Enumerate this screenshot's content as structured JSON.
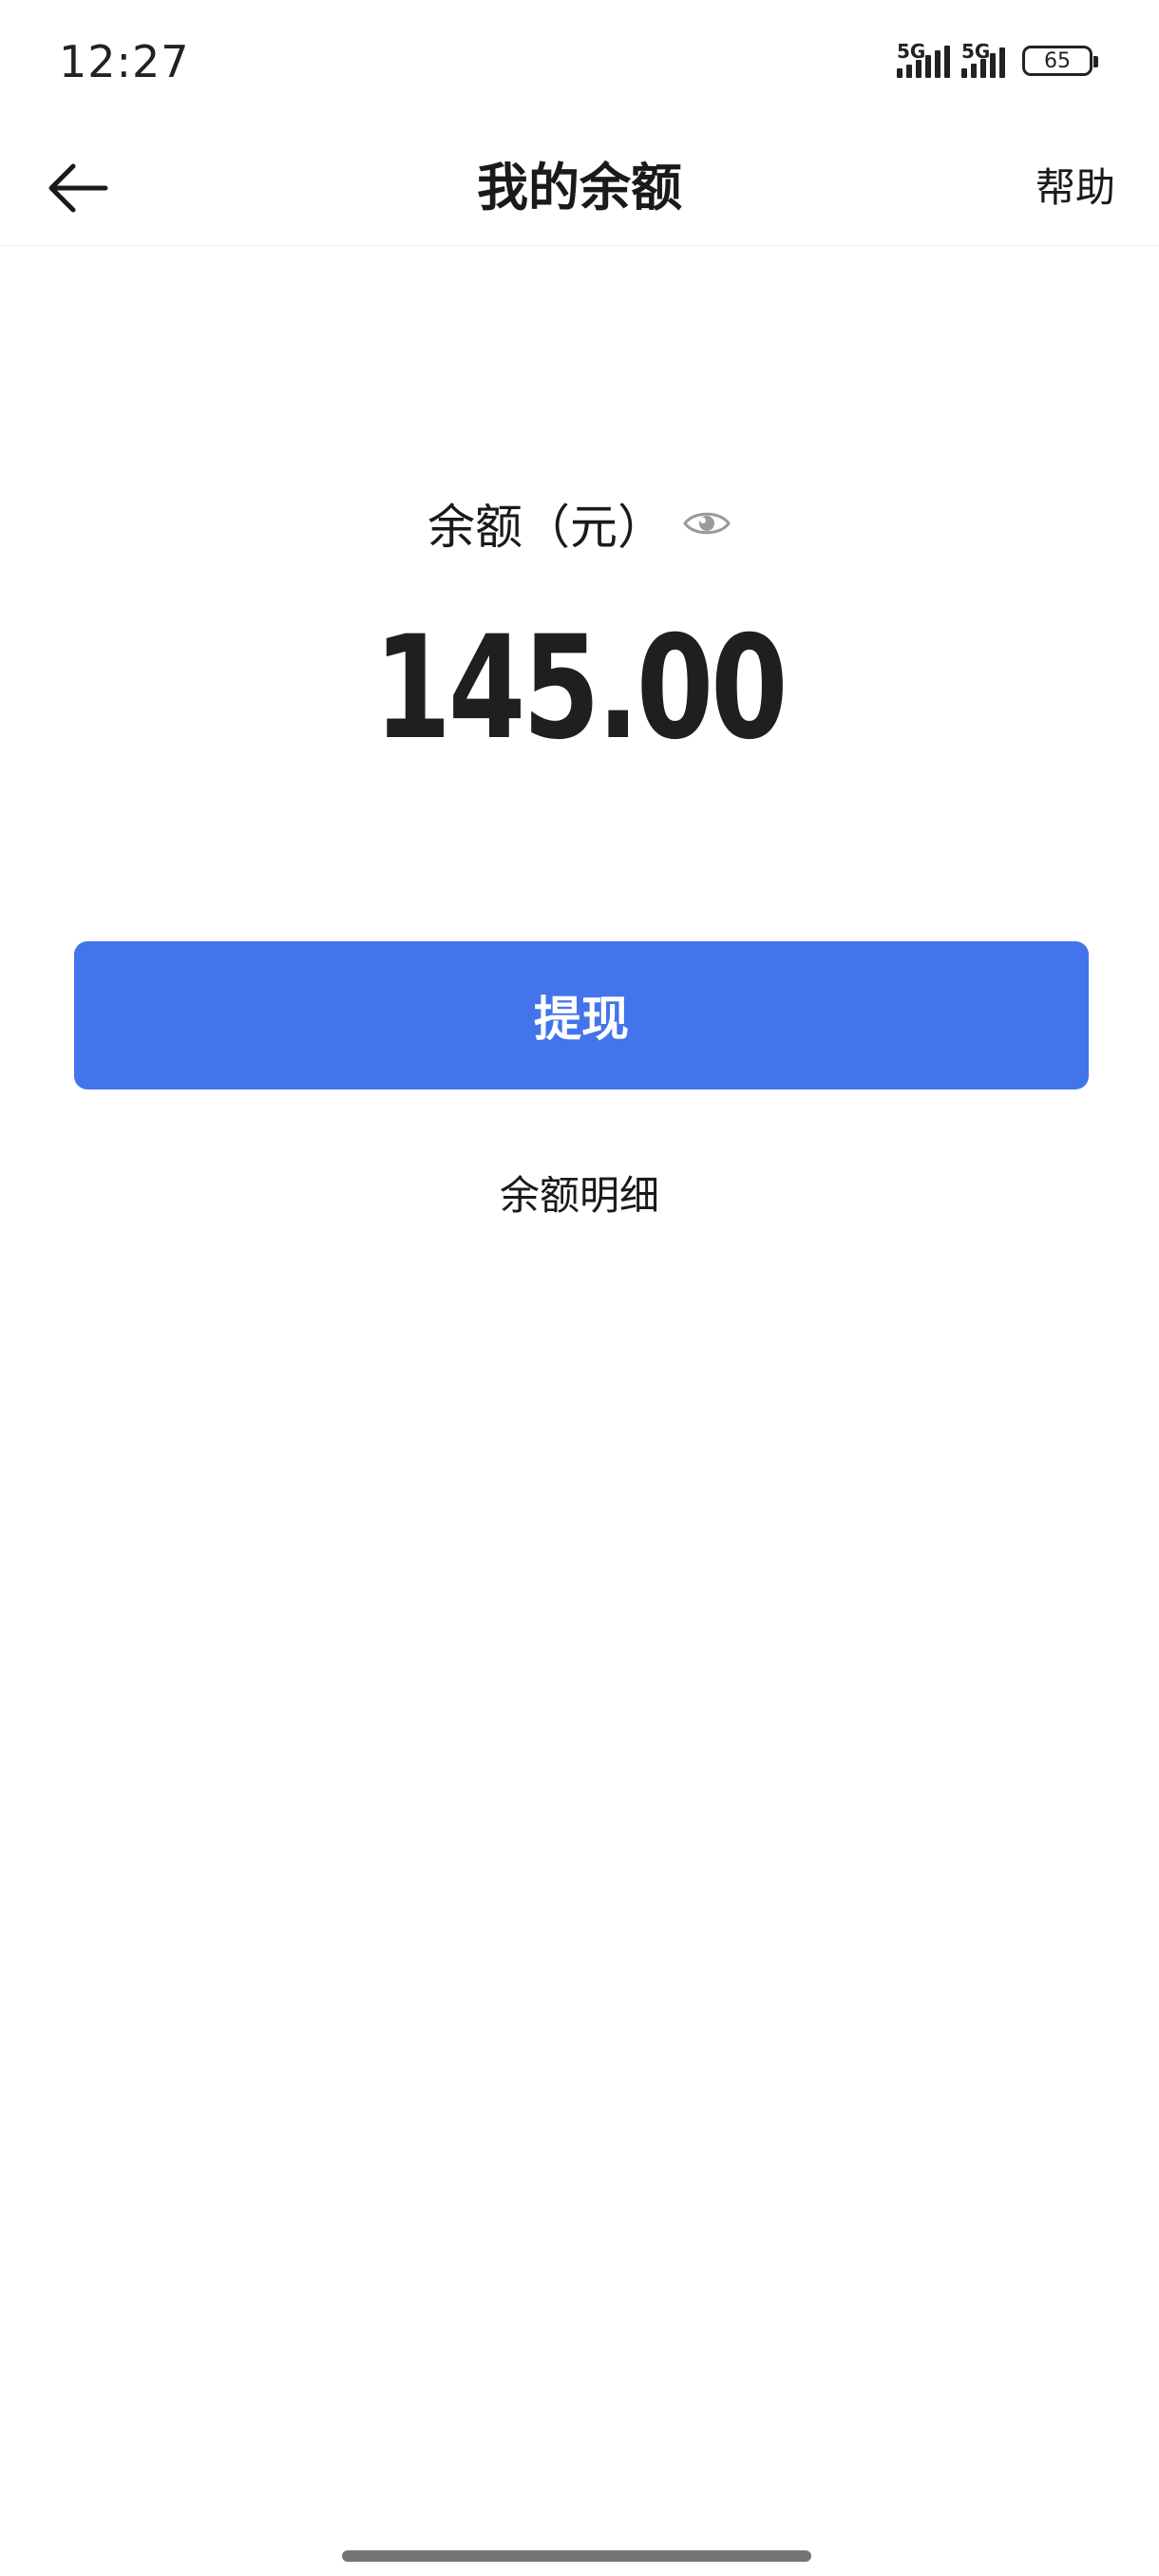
{
  "status_bar": {
    "time": "12:27",
    "signal_1_label": "5G",
    "signal_2_label": "5G",
    "battery_level": "65"
  },
  "header": {
    "title": "我的余额",
    "help_label": "帮助",
    "back_icon": "arrow-left-icon"
  },
  "balance": {
    "label": "余额（元）",
    "eye_icon": "eye-icon",
    "amount": "145.00"
  },
  "actions": {
    "withdraw_label": "提现",
    "detail_label": "余额明细"
  },
  "colors": {
    "primary_button": "#4374ec",
    "text": "#1a1a1a",
    "background": "#ffffff"
  }
}
